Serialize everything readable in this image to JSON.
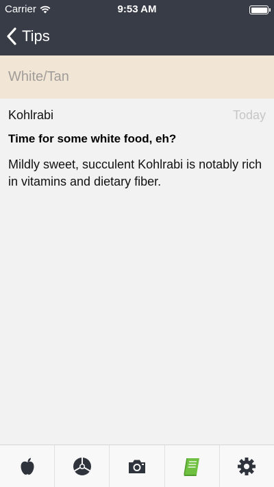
{
  "status_bar": {
    "carrier": "Carrier",
    "time": "9:53 AM"
  },
  "nav": {
    "back_label": "Tips"
  },
  "category": {
    "label": "White/Tan",
    "color": "#f1e5d5"
  },
  "tip": {
    "name": "Kohlrabi",
    "date": "Today",
    "title": "Time for some white food, eh?",
    "body": "Mildly sweet, succulent Kohlrabi is notably rich in vitamins and dietary fiber."
  },
  "tab_bar": {
    "tabs": [
      {
        "icon": "apple-icon",
        "active": false
      },
      {
        "icon": "color-wheel-icon",
        "active": false
      },
      {
        "icon": "camera-icon",
        "active": false
      },
      {
        "icon": "book-icon",
        "active": true
      },
      {
        "icon": "gear-icon",
        "active": false
      }
    ],
    "active_color": "#6fc041",
    "inactive_color": "#2f333b"
  },
  "colors": {
    "header_bg": "#373c47",
    "content_bg": "#f2f2f2"
  }
}
